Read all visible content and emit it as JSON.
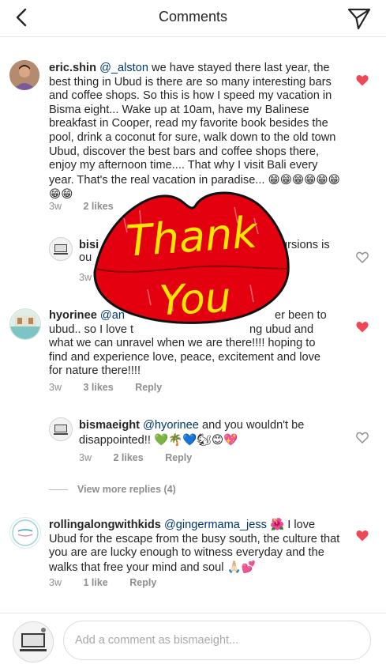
{
  "header": {
    "title": "Comments"
  },
  "comments": [
    {
      "username": "eric.shin",
      "mention": "@_alston",
      "body": " we have stayed there last year, the best thing in Ubud is there are so many interesting bars and coffee shops. So this is how I speed my vacation in Bisma eight... Wake up at 10am, have my Balinese breakfast in Cooper, read my favorite book besides the pool, drink a coconut for sure, walk down to the old town Ubud, discover the best bars and coffee shops there, enjoy my afternoon time.... That why I visit Bali every year. That's the real vacation in paradise...",
      "emojis": "😁😁😁😁😁😁😁😁",
      "time": "3w",
      "likes": "2 likes",
      "liked": true
    },
    {
      "username": "bisi",
      "mention": "",
      "body": "ou",
      "body_right": "ursions is",
      "time": "3w",
      "liked": false
    },
    {
      "username": "hyorinee",
      "mention": "@an",
      "body_tail_1": "er been to",
      "line2": "ubud.. so I love t",
      "line2_tail": "ng ubud and",
      "line3": "what we can unravel when we are there!!!! hoping to",
      "line4": "find and experience love, peace, excitement and love",
      "line5": "for nature there!!!!",
      "time": "3w",
      "likes": "3 likes",
      "reply": "Reply",
      "liked": true
    },
    {
      "username": "bismaeight",
      "mention": "@hyorinee",
      "body": " and you wouldn't be disappointed!!",
      "emojis": "💚🌴💙🐿😊💖",
      "time": "3w",
      "likes": "2 likes",
      "reply": "Reply",
      "liked": false
    },
    {
      "username": "rollingalongwithkids",
      "mention": "@gingermama_jess",
      "emoji_inline": "🌺",
      "body": " I love Ubud for the escape from the busy south, the culture that you are are lucky enough to witness everyday and the walks that free your mind and soul",
      "emojis": "🙏🏻💕",
      "time": "3w",
      "likes": "1 like",
      "reply": "Reply",
      "liked": true
    }
  ],
  "view_more": "View more replies (4)",
  "sticker": {
    "line1": "Thank",
    "line2": "You",
    "color": "#e3000f",
    "text_color": "#ffe600"
  },
  "composer": {
    "placeholder": "Add a comment as bismaeight..."
  },
  "colors": {
    "heart_liked": "#ed4956",
    "heart_outline": "#8e8e8e",
    "mention": "#00376b"
  }
}
